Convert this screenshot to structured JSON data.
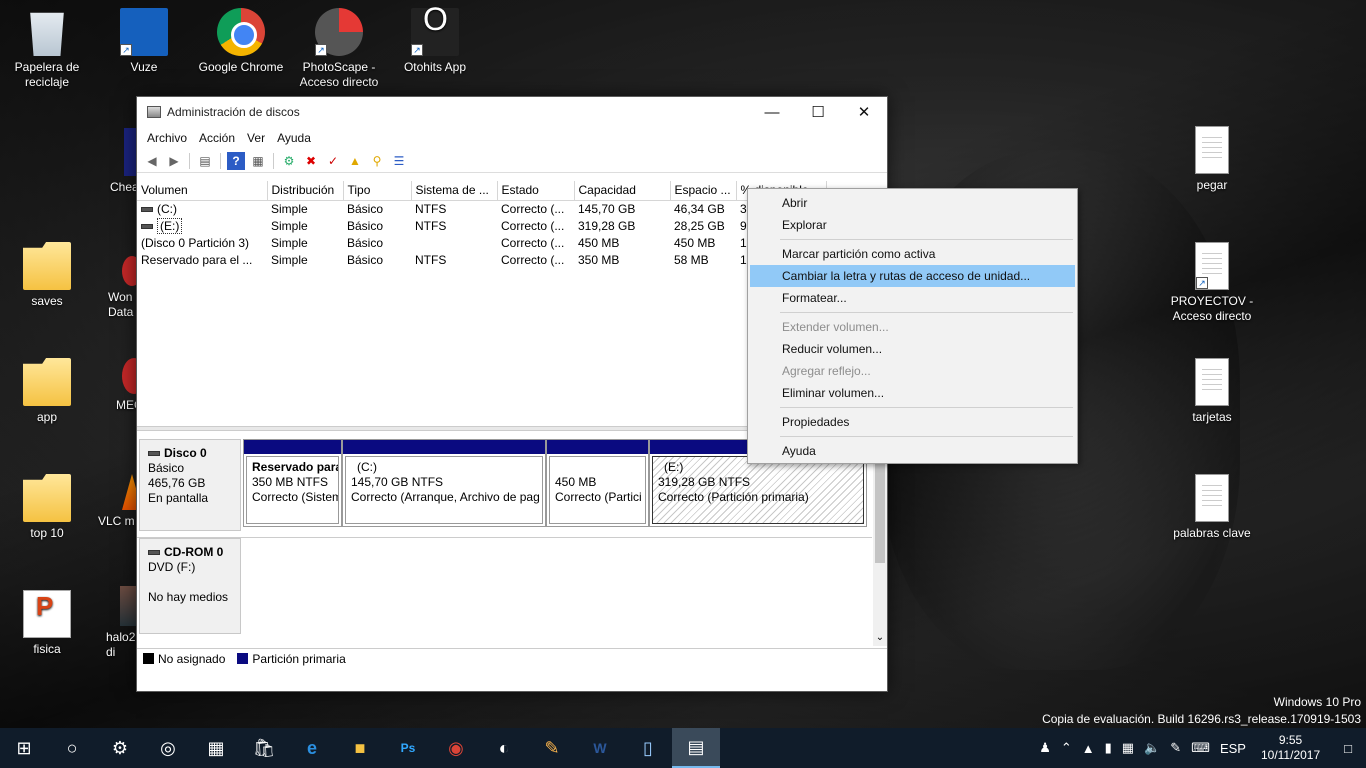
{
  "desktop": {
    "icons": [
      {
        "name": "recycle-bin",
        "label": "Papelera de\nreciclaje"
      },
      {
        "name": "vuze",
        "label": "Vuze"
      },
      {
        "name": "chrome",
        "label": "Google Chrome"
      },
      {
        "name": "photoscape",
        "label": "PhotoScape -\nAcceso directo"
      },
      {
        "name": "otohits",
        "label": "Otohits App"
      },
      {
        "name": "saves",
        "label": "saves"
      },
      {
        "name": "app",
        "label": "app"
      },
      {
        "name": "top10",
        "label": "top 10"
      },
      {
        "name": "fisica",
        "label": "fisica"
      },
      {
        "name": "cheat",
        "label": "Chea"
      },
      {
        "name": "wondershare",
        "label": "Won\nData"
      },
      {
        "name": "mega",
        "label": "MEG"
      },
      {
        "name": "vlc",
        "label": "VLC m"
      },
      {
        "name": "halo",
        "label": "halo2\ndi"
      },
      {
        "name": "pegar",
        "label": "pegar"
      },
      {
        "name": "proyectov",
        "label": "PROYECTOV -\nAcceso directo"
      },
      {
        "name": "tarjetas",
        "label": "tarjetas"
      },
      {
        "name": "palabras",
        "label": "palabras clave"
      }
    ]
  },
  "window": {
    "title": "Administración de discos",
    "menu": [
      "Archivo",
      "Acción",
      "Ver",
      "Ayuda"
    ],
    "columns": [
      "Volumen",
      "Distribución",
      "Tipo",
      "Sistema de ...",
      "Estado",
      "Capacidad",
      "Espacio ...",
      "% disponible"
    ],
    "rows": [
      [
        "(C:)",
        "Simple",
        "Básico",
        "NTFS",
        "Correcto (...",
        "145,70 GB",
        "46,34 GB",
        "3"
      ],
      [
        "(E:)",
        "Simple",
        "Básico",
        "NTFS",
        "Correcto (...",
        "319,28 GB",
        "28,25 GB",
        "9"
      ],
      [
        "(Disco 0 Partición 3)",
        "Simple",
        "Básico",
        "",
        "Correcto (...",
        "450 MB",
        "450 MB",
        "1"
      ],
      [
        "Reservado para el ...",
        "Simple",
        "Básico",
        "NTFS",
        "Correcto (...",
        "350 MB",
        "58 MB",
        "1"
      ]
    ],
    "disk0": {
      "name": "Disco 0",
      "type": "Básico",
      "size": "465,76 GB",
      "status": "En pantalla",
      "partitions": [
        {
          "title": "Reservado para",
          "size": "350 MB NTFS",
          "status": "Correcto (Sistem"
        },
        {
          "title": "(C:)",
          "size": "145,70 GB NTFS",
          "status": "Correcto (Arranque, Archivo de pag"
        },
        {
          "title": "",
          "size": "450 MB",
          "status": "Correcto (Partici"
        },
        {
          "title": "(E:)",
          "size": "319,28 GB NTFS",
          "status": "Correcto (Partición primaria)"
        }
      ]
    },
    "cdrom": {
      "name": "CD-ROM 0",
      "type": "DVD (F:)",
      "status": "No hay medios"
    },
    "legend": [
      {
        "label": "No asignado",
        "color": "#000000"
      },
      {
        "label": "Partición primaria",
        "color": "#0a0a80"
      }
    ]
  },
  "context_menu": {
    "items": [
      {
        "label": "Abrir",
        "disabled": false
      },
      {
        "label": "Explorar",
        "disabled": false
      },
      {
        "label": "Marcar partición como activa",
        "disabled": false
      },
      {
        "label": "Cambiar la letra y rutas de acceso de unidad...",
        "disabled": false,
        "highlighted": true
      },
      {
        "label": "Formatear...",
        "disabled": false
      },
      {
        "label": "Extender volumen...",
        "disabled": true
      },
      {
        "label": "Reducir volumen...",
        "disabled": false
      },
      {
        "label": "Agregar reflejo...",
        "disabled": true
      },
      {
        "label": "Eliminar volumen...",
        "disabled": false
      },
      {
        "label": "Propiedades",
        "disabled": false
      },
      {
        "label": "Ayuda",
        "disabled": false
      }
    ]
  },
  "watermark": {
    "line1": "Windows 10 Pro",
    "line2": "Copia de evaluación. Build 16296.rs3_release.170919-1503"
  },
  "taskbar": {
    "language": "ESP",
    "time": "9:55",
    "date": "10/11/2017"
  },
  "colors": {
    "primary_partition": "#0a0a80",
    "highlight": "#91c9f7",
    "taskbar": "#101c2a"
  }
}
